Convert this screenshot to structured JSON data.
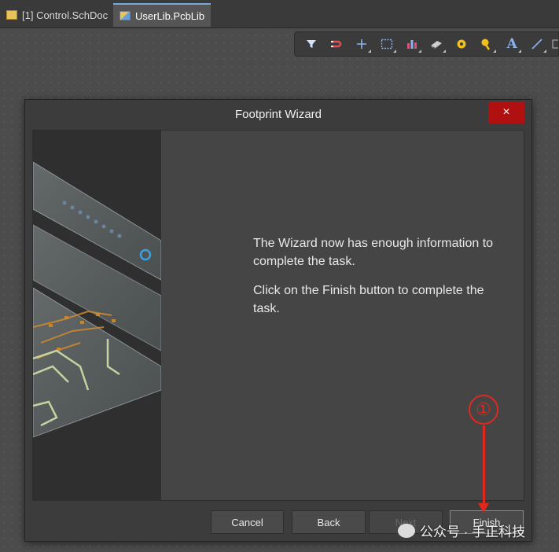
{
  "tabs": [
    {
      "label": "[1] Control.SchDoc",
      "active": false
    },
    {
      "label": "UserLib.PcbLib",
      "active": true
    }
  ],
  "toolbar": {
    "icons": [
      "filter-icon",
      "magnet-icon",
      "plus-icon",
      "select-rect-icon",
      "chart-icon",
      "component-icon",
      "pad-icon",
      "via-icon",
      "text-icon",
      "line-icon"
    ],
    "text_tool_glyph": "A"
  },
  "dialog": {
    "title": "Footprint Wizard",
    "close_glyph": "×",
    "message_line1": "The Wizard now has enough information to complete the task.",
    "message_line2": "Click on the Finish button to complete the task.",
    "buttons": {
      "cancel": "Cancel",
      "back": "Back",
      "next": "Next",
      "finish": "Finish"
    }
  },
  "annotation": {
    "marker": "①",
    "color": "#e0281e"
  },
  "watermark": {
    "text": "公众号 · 手正科技"
  },
  "colors": {
    "close_button": "#b01010",
    "dialog_bg": "#3c3c3c",
    "content_bg": "#454545"
  }
}
